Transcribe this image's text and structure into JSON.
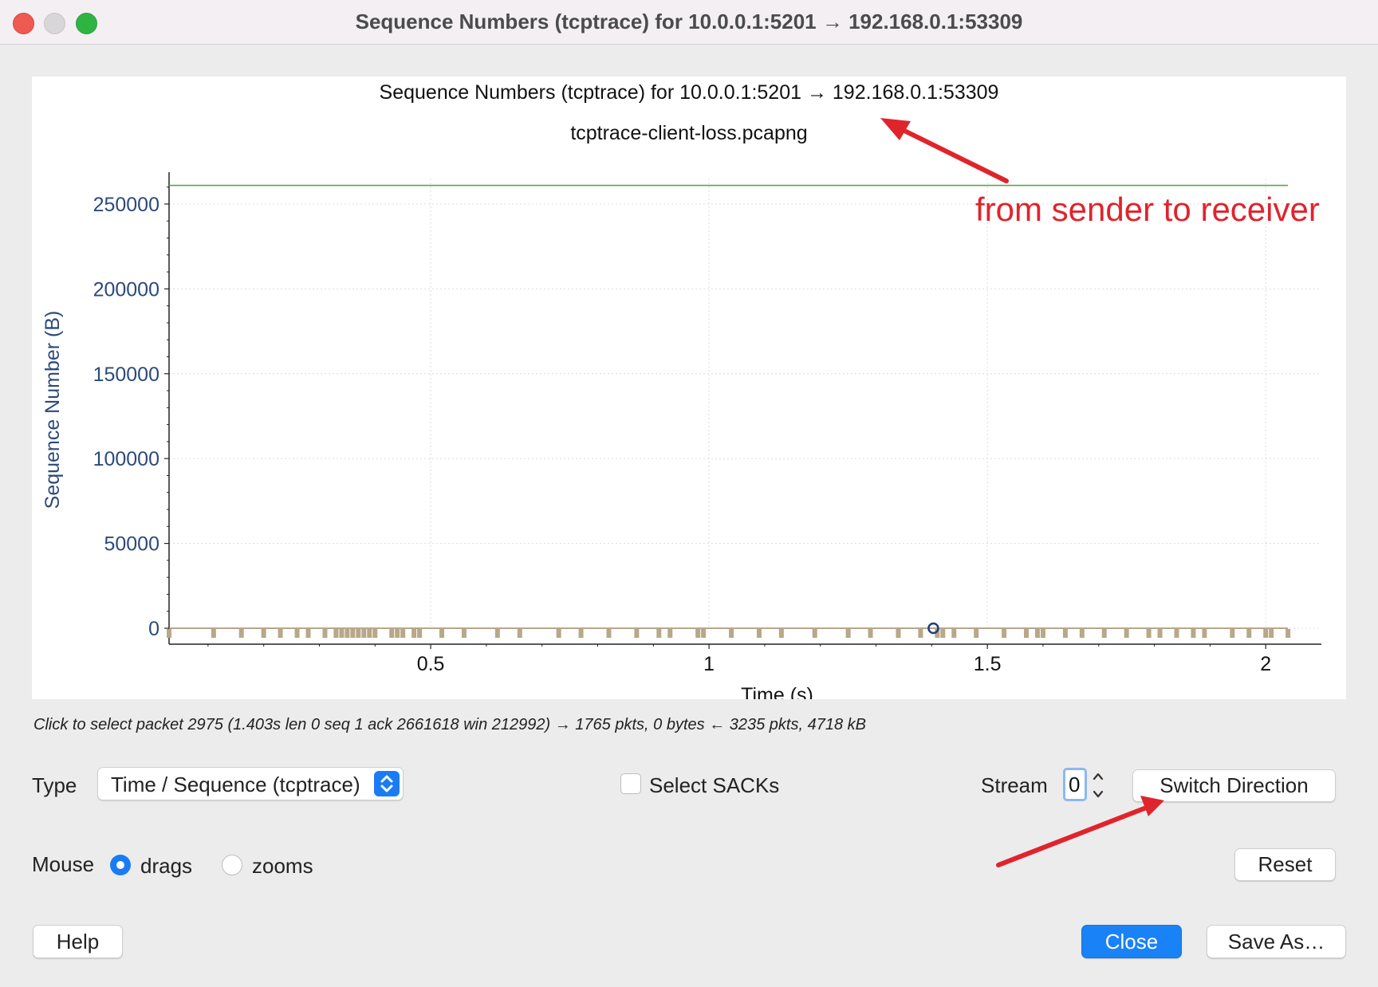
{
  "window": {
    "title": "Sequence Numbers (tcptrace) for 10.0.0.1:5201 → 192.168.0.1:53309"
  },
  "plot": {
    "title": "Sequence Numbers (tcptrace) for 10.0.0.1:5201 → 192.168.0.1:53309",
    "subtitle": "tcptrace-client-loss.pcapng"
  },
  "annotation": {
    "text": "from sender to receiver",
    "color": "#e0242c"
  },
  "chart_data": {
    "type": "scatter",
    "title": "Sequence Numbers (tcptrace) for 10.0.0.1:5201 → 192.168.0.1:53309",
    "subtitle": "tcptrace-client-loss.pcapng",
    "xlabel": "Time (s)",
    "ylabel": "Sequence Number (B)",
    "xlim": [
      0.03,
      2.1
    ],
    "ylim": [
      0,
      265000
    ],
    "x_ticks": [
      "0.5",
      "1",
      "1.5",
      "2"
    ],
    "x_tick_values": [
      0.5,
      1,
      1.5,
      2
    ],
    "y_ticks": [
      "0",
      "50000",
      "100000",
      "150000",
      "200000",
      "250000"
    ],
    "y_tick_values": [
      0,
      50000,
      100000,
      150000,
      200000,
      250000
    ],
    "grid": true,
    "series": [
      {
        "kind": "window-line",
        "color": "#5aa64a",
        "x": [
          0.03,
          2.04
        ],
        "y": [
          261000,
          261000
        ]
      },
      {
        "kind": "ack-line",
        "color": "#a08868",
        "x": [
          0.03,
          2.04
        ],
        "y": [
          1,
          1
        ]
      },
      {
        "kind": "data-segments",
        "color": "#b8a888",
        "x": [
          0.03,
          0.11,
          0.16,
          0.2,
          0.23,
          0.26,
          0.28,
          0.31,
          0.33,
          0.34,
          0.35,
          0.36,
          0.37,
          0.38,
          0.39,
          0.4,
          0.43,
          0.44,
          0.45,
          0.47,
          0.48,
          0.52,
          0.56,
          0.62,
          0.66,
          0.73,
          0.77,
          0.82,
          0.87,
          0.91,
          0.93,
          0.98,
          0.99,
          1.04,
          1.09,
          1.13,
          1.19,
          1.25,
          1.29,
          1.34,
          1.38,
          1.41,
          1.42,
          1.44,
          1.48,
          1.53,
          1.57,
          1.59,
          1.6,
          1.64,
          1.67,
          1.71,
          1.75,
          1.79,
          1.81,
          1.84,
          1.87,
          1.89,
          1.94,
          1.97,
          2.0,
          2.01,
          2.04
        ],
        "y": [
          0,
          0,
          0,
          0,
          0,
          0,
          0,
          0,
          0,
          0,
          0,
          0,
          0,
          0,
          0,
          0,
          0,
          0,
          0,
          0,
          0,
          0,
          0,
          0,
          0,
          0,
          0,
          0,
          0,
          0,
          0,
          0,
          0,
          0,
          0,
          0,
          0,
          0,
          0,
          0,
          0,
          0,
          0,
          0,
          0,
          0,
          0,
          0,
          0,
          0,
          0,
          0,
          0,
          0,
          0,
          0,
          0,
          0,
          0,
          0,
          0,
          0,
          0
        ]
      },
      {
        "kind": "selected-packet",
        "color": "#1f3f7a",
        "x": [
          1.403
        ],
        "y": [
          1
        ]
      }
    ]
  },
  "status": {
    "text": "Click to select packet 2975 (1.403s len 0 seq 1 ack 2661618 win 212992) → 1765 pkts, 0 bytes ← 3235 pkts, 4718 kB"
  },
  "controls": {
    "type_label": "Type",
    "type_value": "Time / Sequence (tcptrace)",
    "select_sacks_label": "Select SACKs",
    "stream_label": "Stream",
    "stream_value": "0",
    "switch_direction_label": "Switch Direction",
    "mouse_label": "Mouse",
    "drags_label": "drags",
    "zooms_label": "zooms",
    "reset_label": "Reset",
    "help_label": "Help",
    "close_label": "Close",
    "save_as_label": "Save As…"
  },
  "colors": {
    "axis_text": "#2c4a7a",
    "accent": "#1a7cf5"
  }
}
